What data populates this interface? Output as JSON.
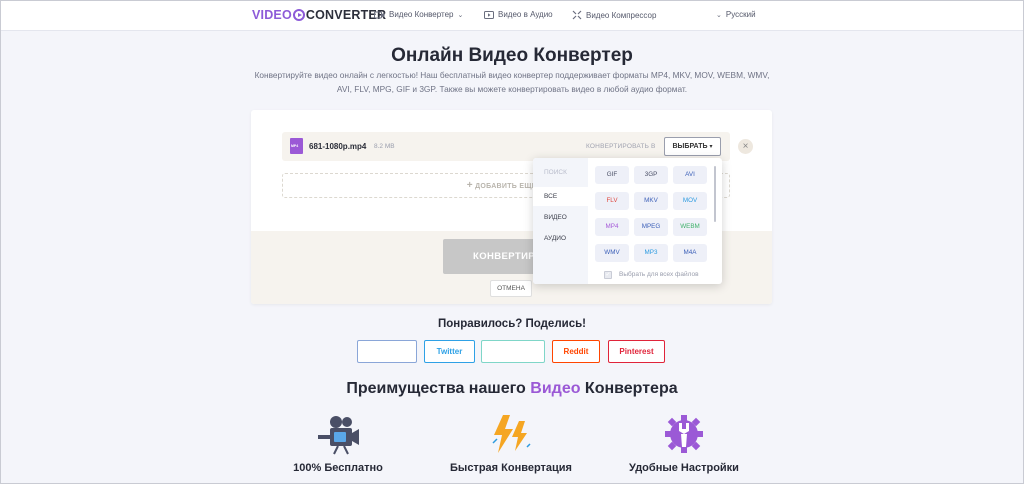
{
  "header": {
    "logo_left": "VIDEO",
    "logo_right": "CONVERTER",
    "nav": [
      {
        "label": "Видео Конвертер",
        "icon": "video-icon"
      },
      {
        "label": "Видео в Аудио",
        "icon": "play-icon"
      },
      {
        "label": "Видео Компрессор",
        "icon": "compress-icon"
      }
    ],
    "language": "Русский"
  },
  "hero": {
    "title": "Онлайн Видео Конвертер",
    "subtitle": "Конвертируйте видео онлайн с легкостью! Наш бесплатный видео конвертер поддерживает форматы MP4, MKV, MOV, WEBM, WMV, AVI, FLV, MPG, GIF и 3GP. Также вы можете конвертировать видео в любой аудио формат."
  },
  "converter": {
    "file_name": "681-1080p.mp4",
    "file_size": "8.2 MB",
    "convert_to_label": "КОНВЕРТИРОВАТЬ В",
    "select_label": "ВЫБРАТЬ",
    "add_more_label": "ДОБАВИТЬ ЕЩЕ Ф",
    "convert_button": "КОНВЕРТИРОВ",
    "cancel_button": "ОТМЕНА"
  },
  "dropdown": {
    "search_placeholder": "ПОИСК",
    "categories": [
      "ВСЕ",
      "ВИДЕО",
      "АУДИО"
    ],
    "formats": [
      {
        "label": "GIF",
        "color": "#4a4f66"
      },
      {
        "label": "3GP",
        "color": "#4a4f66"
      },
      {
        "label": "AVI",
        "color": "#3b5fb8"
      },
      {
        "label": "FLV",
        "color": "#e0483f"
      },
      {
        "label": "MKV",
        "color": "#3b5fb8"
      },
      {
        "label": "MOV",
        "color": "#2d9be0"
      },
      {
        "label": "MP4",
        "color": "#a55bd8"
      },
      {
        "label": "MPEG",
        "color": "#3b5fb8"
      },
      {
        "label": "WEBM",
        "color": "#3fb26a"
      },
      {
        "label": "WMV",
        "color": "#3b5fb8"
      },
      {
        "label": "MP3",
        "color": "#2d9be0"
      },
      {
        "label": "M4A",
        "color": "#3b5fb8"
      }
    ],
    "apply_all": "Выбрать для всех файлов"
  },
  "share": {
    "title": "Понравилось? Поделись!",
    "buttons": [
      {
        "label": "",
        "color": "#8aa6d8"
      },
      {
        "label": "Twitter",
        "color": "#2ea1e6"
      },
      {
        "label": "",
        "color": "#7fd6c8"
      },
      {
        "label": "Reddit",
        "color": "#ff4500"
      },
      {
        "label": "Pinterest",
        "color": "#e0243a"
      }
    ]
  },
  "features": {
    "title_before": "Преимущества нашего ",
    "title_highlight": "Видео",
    "title_after": " Конвертера",
    "items": [
      {
        "label": "100% Бесплатно",
        "icon": "video-camera-icon"
      },
      {
        "label": "Быстрая Конвертация",
        "icon": "lightning-icon"
      },
      {
        "label": "Удобные Настройки",
        "icon": "wrench-gear-icon"
      }
    ]
  },
  "colors": {
    "accent": "#9b59d6",
    "lightning": "#f5a623"
  }
}
